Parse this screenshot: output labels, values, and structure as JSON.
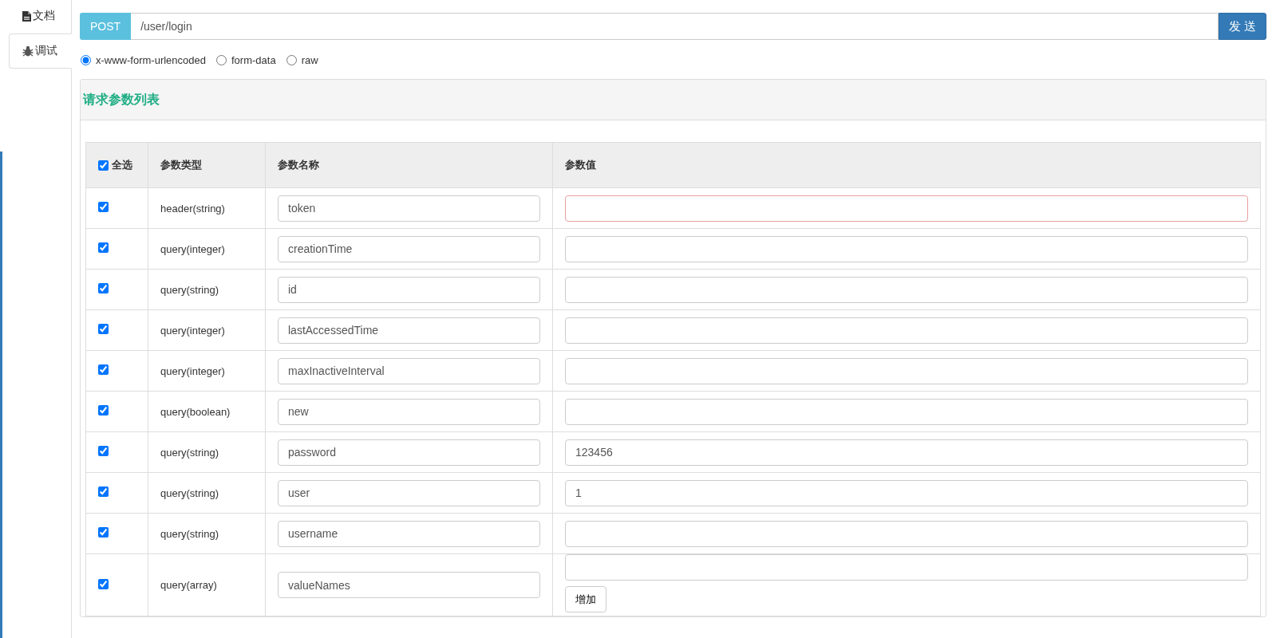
{
  "side_tabs": [
    {
      "label": "文档",
      "kind": "document",
      "selected": false
    },
    {
      "label": "调试",
      "kind": "debug",
      "selected": true
    }
  ],
  "request": {
    "method": "POST",
    "url": "/user/login",
    "send_button": "发 送"
  },
  "body_types": [
    {
      "label": "x-www-form-urlencoded",
      "selected": true
    },
    {
      "label": "form-data",
      "selected": false
    },
    {
      "label": "raw",
      "selected": false
    }
  ],
  "panel": {
    "title": "请求参数列表",
    "table": {
      "select_all": {
        "label": "全选",
        "checked": true
      },
      "columns": [
        "参数类型",
        "参数名称",
        "参数值"
      ],
      "rows": [
        {
          "checked": true,
          "type": "header(string)",
          "name": "token",
          "value": "",
          "invalid": true
        },
        {
          "checked": true,
          "type": "query(integer)",
          "name": "creationTime",
          "value": "",
          "invalid": false
        },
        {
          "checked": true,
          "type": "query(string)",
          "name": "id",
          "value": "",
          "invalid": false
        },
        {
          "checked": true,
          "type": "query(integer)",
          "name": "lastAccessedTime",
          "value": "",
          "invalid": false
        },
        {
          "checked": true,
          "type": "query(integer)",
          "name": "maxInactiveInterval",
          "value": "",
          "invalid": false
        },
        {
          "checked": true,
          "type": "query(boolean)",
          "name": "new",
          "value": "",
          "invalid": false
        },
        {
          "checked": true,
          "type": "query(string)",
          "name": "password",
          "value": "123456",
          "invalid": false
        },
        {
          "checked": true,
          "type": "query(string)",
          "name": "user",
          "value": "1",
          "invalid": false
        },
        {
          "checked": true,
          "type": "query(string)",
          "name": "username",
          "value": "",
          "invalid": false
        },
        {
          "checked": true,
          "type": "query(array)",
          "name": "valueNames",
          "value": "",
          "invalid": false,
          "add_button": "增加"
        }
      ]
    }
  }
}
